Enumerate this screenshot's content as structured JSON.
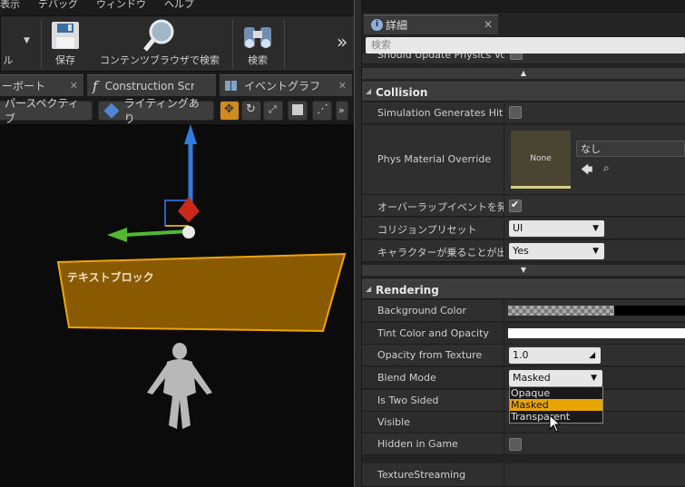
{
  "menu": {
    "items": [
      "表示",
      "デバッグ",
      "ウィンドウ",
      "ヘルプ"
    ]
  },
  "toolbar": {
    "partial_label": "ル",
    "save_label": "保存",
    "content_browser_label": "コンテンツブラウザで検索",
    "search_label": "検索",
    "overflow": "»"
  },
  "tabs": {
    "tab1": "ーボート",
    "tab2": "Construction Scrip",
    "tab3": "イベントグラフ"
  },
  "viewport_toolbar": {
    "perspective": "パースペクティブ",
    "lighting": "ライティングあり"
  },
  "viewport": {
    "text_block_label": "テキストブロック"
  },
  "details": {
    "tab_label": "詳細",
    "search_placeholder": "検索",
    "clipped_row": "Should Update Physics Volu",
    "collision": {
      "title": "Collision",
      "sim_hit_events": "Simulation Generates Hit Ev",
      "phys_material": "Phys Material Override",
      "thumb_text": "None",
      "phys_value": "なし",
      "overlap_events": "オーバーラップイベントを発",
      "collision_preset": "コリジョンプリセット",
      "collision_preset_value": "UI",
      "can_step_up": "キャラクターが乗ることが出",
      "can_step_up_value": "Yes"
    },
    "rendering": {
      "title": "Rendering",
      "background_color": "Background Color",
      "tint_color": "Tint Color and Opacity",
      "opacity_from_texture": "Opacity from Texture",
      "opacity_value": "1.0",
      "blend_mode": "Blend Mode",
      "blend_mode_value": "Masked",
      "two_sided": "Is Two Sided",
      "visible": "Visible",
      "hidden_in_game": "Hidden in Game",
      "texture_streaming": "TextureStreaming"
    },
    "blend_options": [
      "Opaque",
      "Masked",
      "Transparent"
    ]
  },
  "colors": {
    "accent": "#e8a400",
    "panel": "#2f2f2f",
    "textblock_fill": "#8a5a00"
  }
}
